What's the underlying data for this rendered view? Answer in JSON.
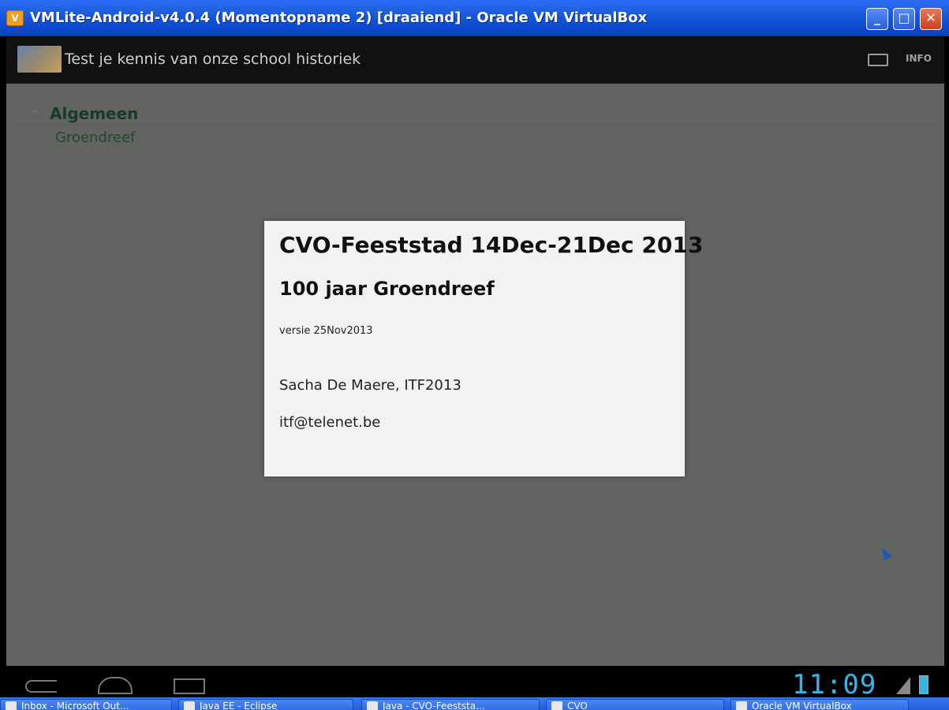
{
  "window": {
    "title": "VMLite-Android-v4.0.4 (Momentopname 2) [draaiend] - Oracle VM VirtualBox",
    "minimize_label": "_",
    "maximize_label": "□",
    "close_label": "✕",
    "icon_letter": "V"
  },
  "actionbar": {
    "title": "Test je kennis van onze school historiek",
    "info_label": "INFO"
  },
  "list": {
    "group_chevron": "^",
    "group_label": "Algemeen",
    "child_label": "Groendreef"
  },
  "dialog": {
    "title": "CVO-Feeststad 14Dec-21Dec 2013",
    "subtitle": "100 jaar Groendreef",
    "version": "versie 25Nov2013",
    "author": "Sacha De Maere, ITF2013",
    "email": "itf@telenet.be"
  },
  "navbar": {
    "clock": "11:09"
  },
  "taskbar": {
    "items": [
      {
        "label": "Inbox - Microsoft Out..."
      },
      {
        "label": "Java EE - Eclipse"
      },
      {
        "label": "Java - CVO-Feeststa..."
      },
      {
        "label": "CVO"
      },
      {
        "label": "Oracle VM VirtualBox"
      }
    ]
  },
  "colors": {
    "xp_blue": "#0d4bd0",
    "android_holo_blue": "#33b5e5",
    "dim_overlay": "#616461"
  }
}
